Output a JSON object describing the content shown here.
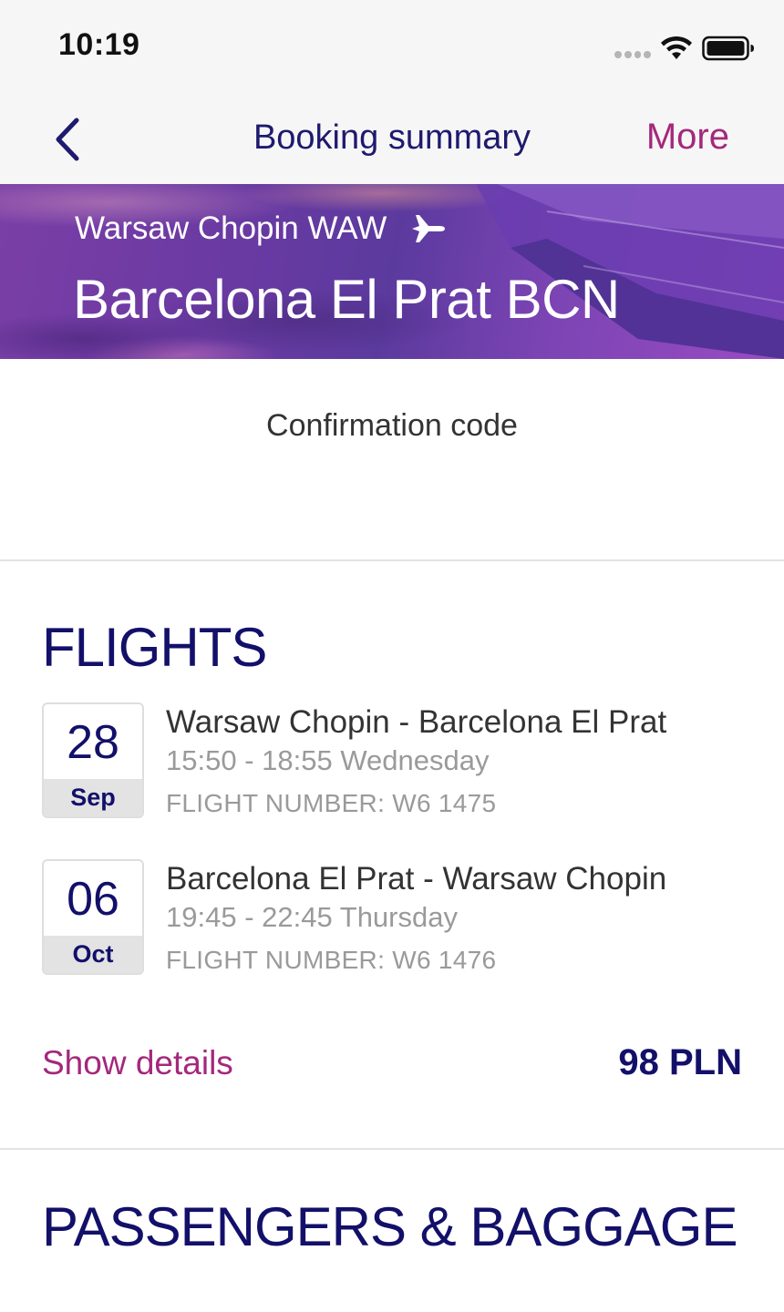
{
  "status_bar": {
    "time": "10:19",
    "icons": [
      "signal-dots-icon",
      "wifi-icon",
      "battery-icon"
    ]
  },
  "nav": {
    "back_icon": "chevron-left-icon",
    "title": "Booking summary",
    "more_label": "More"
  },
  "hero": {
    "origin": "Warsaw Chopin WAW",
    "plane_icon": "airplane-icon",
    "destination": "Barcelona El Prat BCN"
  },
  "confirmation": {
    "label": "Confirmation code"
  },
  "flights": {
    "heading": "FLIGHTS",
    "items": [
      {
        "day": "28",
        "month": "Sep",
        "route": "Warsaw Chopin - Barcelona El Prat",
        "time": "15:50 - 18:55 Wednesday",
        "flight_number": "FLIGHT NUMBER: W6 1475"
      },
      {
        "day": "06",
        "month": "Oct",
        "route": "Barcelona El Prat - Warsaw Chopin",
        "time": "19:45 - 22:45 Thursday",
        "flight_number": "FLIGHT NUMBER: W6 1476"
      }
    ],
    "show_details_label": "Show details",
    "price": "98 PLN"
  },
  "passengers": {
    "heading": "PASSENGERS & BAGGAGE"
  },
  "colors": {
    "brand_navy": "#13106a",
    "accent_magenta": "#a4287c",
    "muted_gray": "#9a9a9a"
  }
}
